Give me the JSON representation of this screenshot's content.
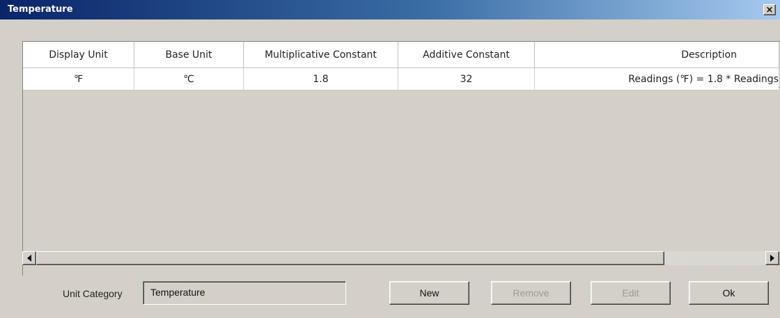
{
  "window": {
    "title": "Temperature",
    "close_glyph": "×"
  },
  "table": {
    "columns": [
      "Display Unit",
      "Base Unit",
      "Multiplicative Constant",
      "Additive Constant",
      "Description"
    ],
    "rows": [
      [
        "℉",
        "℃",
        "1.8",
        "32",
        "Readings (℉) = 1.8 * Readings"
      ]
    ]
  },
  "scrollbar": {
    "left_arrow": "left-arrow-icon",
    "right_arrow": "right-arrow-icon"
  },
  "footer": {
    "unit_category_label": "Unit Category",
    "unit_category_value": "Temperature",
    "new_label": "New",
    "remove_label": "Remove",
    "edit_label": "Edit",
    "ok_label": "Ok"
  }
}
